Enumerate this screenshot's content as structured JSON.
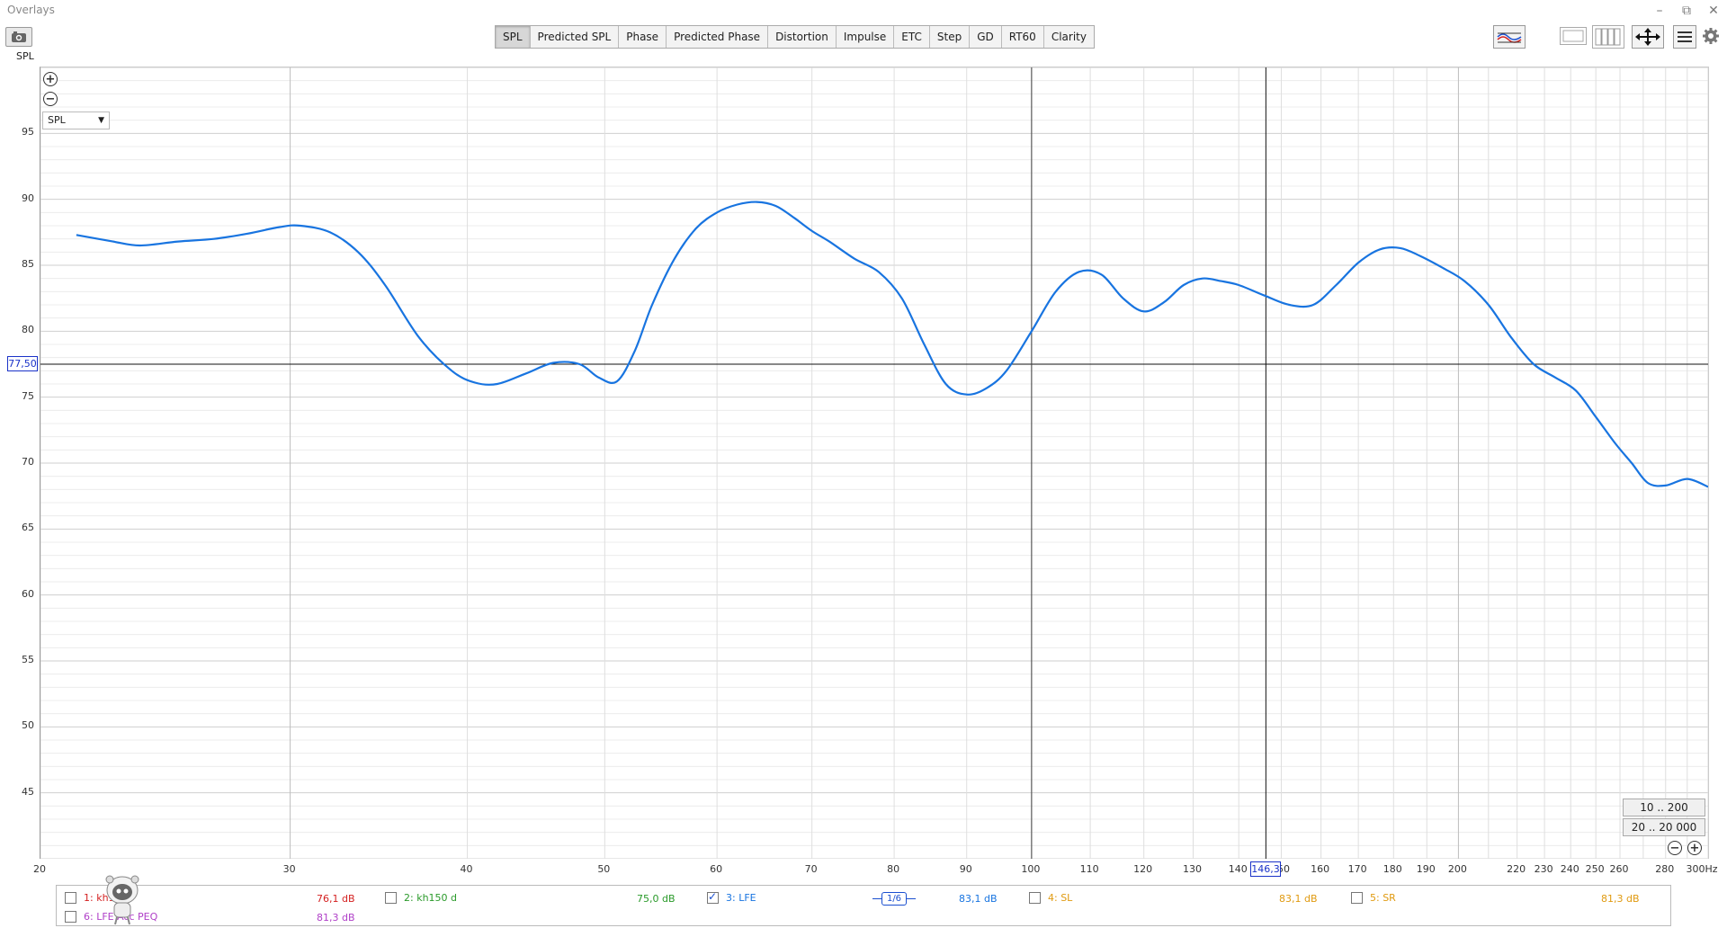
{
  "window": {
    "title": "Overlays",
    "side_label": "SPL"
  },
  "tabs": [
    "SPL",
    "Predicted SPL",
    "Phase",
    "Predicted Phase",
    "Distortion",
    "Impulse",
    "ETC",
    "Step",
    "GD",
    "RT60",
    "Clarity"
  ],
  "active_tab": "SPL",
  "plot": {
    "select_value": "SPL",
    "cursor_y": "77,50",
    "cursor_x": "146,3",
    "range_buttons": [
      "10 .. 200",
      "20 .. 20 000"
    ],
    "trace_color": "#1874e0"
  },
  "chart_data": {
    "type": "line",
    "x_scale": "log",
    "xlim": [
      20,
      300
    ],
    "ylim": [
      40,
      100
    ],
    "x_ticks": [
      "20",
      "30",
      "40",
      "50",
      "60",
      "70",
      "80",
      "90",
      "100",
      "110",
      "120",
      "130",
      "140",
      "150",
      "160",
      "170",
      "180",
      "190",
      "200",
      "220",
      "230",
      "240",
      "250",
      "260",
      "280",
      "300Hz"
    ],
    "y_ticks": [
      95,
      90,
      85,
      80,
      75,
      70,
      65,
      60,
      55,
      50,
      45
    ],
    "grid": true,
    "series": [
      {
        "name": "3: LFE",
        "color": "#1874e0",
        "x": [
          21.2,
          22.5,
          23.5,
          25,
          26.5,
          28,
          29.5,
          30.5,
          32,
          33.5,
          35,
          37,
          39,
          40.5,
          42,
          44,
          46,
          48,
          49.5,
          51,
          52.5,
          54,
          56,
          58,
          60,
          62,
          64,
          66,
          68,
          70,
          72,
          75,
          78,
          81,
          84,
          87,
          90,
          93,
          96,
          100,
          104,
          108,
          112,
          116,
          120,
          124,
          128,
          132,
          136,
          140,
          146,
          152,
          158,
          164,
          170,
          176,
          182,
          188,
          195,
          202,
          210,
          218,
          226,
          234,
          242,
          250,
          258,
          265,
          272,
          280,
          290,
          300
        ],
        "y": [
          87.3,
          86.8,
          86.5,
          86.8,
          87.0,
          87.4,
          87.9,
          88.0,
          87.5,
          86.0,
          83.5,
          79.5,
          77.0,
          76.1,
          76.0,
          76.8,
          77.6,
          77.5,
          76.5,
          76.2,
          78.5,
          82.0,
          85.5,
          87.8,
          89.0,
          89.6,
          89.8,
          89.5,
          88.6,
          87.6,
          86.8,
          85.5,
          84.5,
          82.5,
          79.0,
          76.0,
          75.2,
          75.7,
          77.0,
          80.0,
          83.0,
          84.5,
          84.3,
          82.5,
          81.5,
          82.2,
          83.5,
          84.0,
          83.8,
          83.5,
          82.7,
          82.0,
          82.0,
          83.5,
          85.2,
          86.2,
          86.3,
          85.7,
          84.8,
          83.8,
          82.0,
          79.5,
          77.5,
          76.5,
          75.5,
          73.5,
          71.5,
          70.0,
          68.5,
          68.3,
          68.8,
          68.2
        ]
      }
    ]
  },
  "legend": {
    "items": [
      {
        "label": "1: kh150",
        "value": "76,1 dB",
        "color": "#d42020",
        "checked": false
      },
      {
        "label": "2: kh150 d",
        "value": "75,0 dB",
        "color": "#2a9a2a",
        "checked": false
      },
      {
        "label": "3: LFE",
        "value": "83,1 dB",
        "color": "#1874e0",
        "checked": true
      },
      {
        "label": "4: SL",
        "value": "83,1 dB",
        "color": "#e09a10",
        "checked": false
      },
      {
        "label": "5: SR",
        "value": "81,3 dB",
        "color": "#e09a10",
        "checked": false
      },
      {
        "label": "6: LFE Acc PEQ",
        "value": "81,3 dB",
        "color": "#b040c8",
        "checked": false
      }
    ],
    "smoothing": "1/6"
  }
}
